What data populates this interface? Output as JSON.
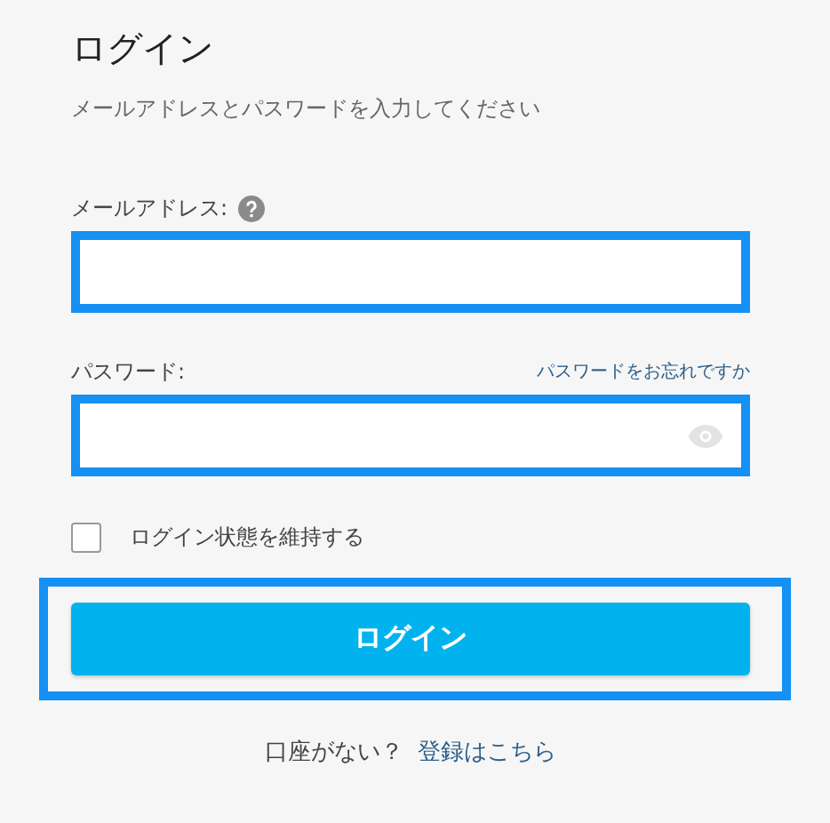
{
  "title": "ログイン",
  "subtitle": "メールアドレスとパスワードを入力してください",
  "fields": [
    {
      "kind": "email",
      "label": "メールアドレス:",
      "help": true,
      "highlighted": true
    },
    {
      "kind": "password",
      "label": "パスワード:",
      "link": "パスワードをお忘れですか",
      "highlighted": true
    }
  ],
  "remember": {
    "label": "ログイン状態を維持する",
    "checked": false
  },
  "submit": {
    "label": "ログイン",
    "highlighted": true
  },
  "footer": {
    "text": "口座がない？",
    "link": "登録はこちら"
  }
}
